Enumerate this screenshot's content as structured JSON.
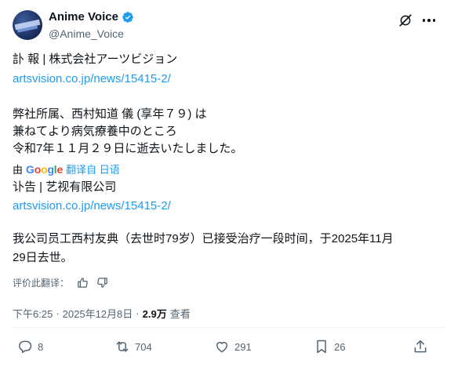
{
  "header": {
    "display_name": "Anime Voice",
    "handle": "@Anime_Voice"
  },
  "original": {
    "line1": "訃 報 | 株式会社アーツビジョン",
    "link": "artsvision.co.jp/news/15415-2/",
    "line2": "弊社所属、西村知道 儀 (享年７９) は",
    "line3": "兼ねてより病気療養中のところ",
    "line4": "令和7年１１月２９日に逝去いたしました。"
  },
  "translation_bar": {
    "by_label": "由",
    "google": [
      "G",
      "o",
      "o",
      "g",
      "l",
      "e"
    ],
    "translated_from": "翻译自 日语"
  },
  "translated": {
    "line1": "讣告 | 艺视有限公司",
    "link": "artsvision.co.jp/news/15415-2/",
    "line2": "我公司员工西村友典（去世时79岁）已接受治疗一段时间，于2025年11月",
    "line3": "29日去世。"
  },
  "rate_translation": {
    "label": "评价此翻译："
  },
  "meta": {
    "time": "下午6:25",
    "sep1": "·",
    "date": "2025年12月8日",
    "sep2": "·",
    "views_count": "2.9万",
    "views_label": "查看"
  },
  "actions": {
    "replies": "8",
    "reposts": "704",
    "likes": "291",
    "bookmarks": "26"
  },
  "colors": {
    "link": "#1d9bf0",
    "verified": "#1d9bf0",
    "secondary_text": "#536471"
  }
}
